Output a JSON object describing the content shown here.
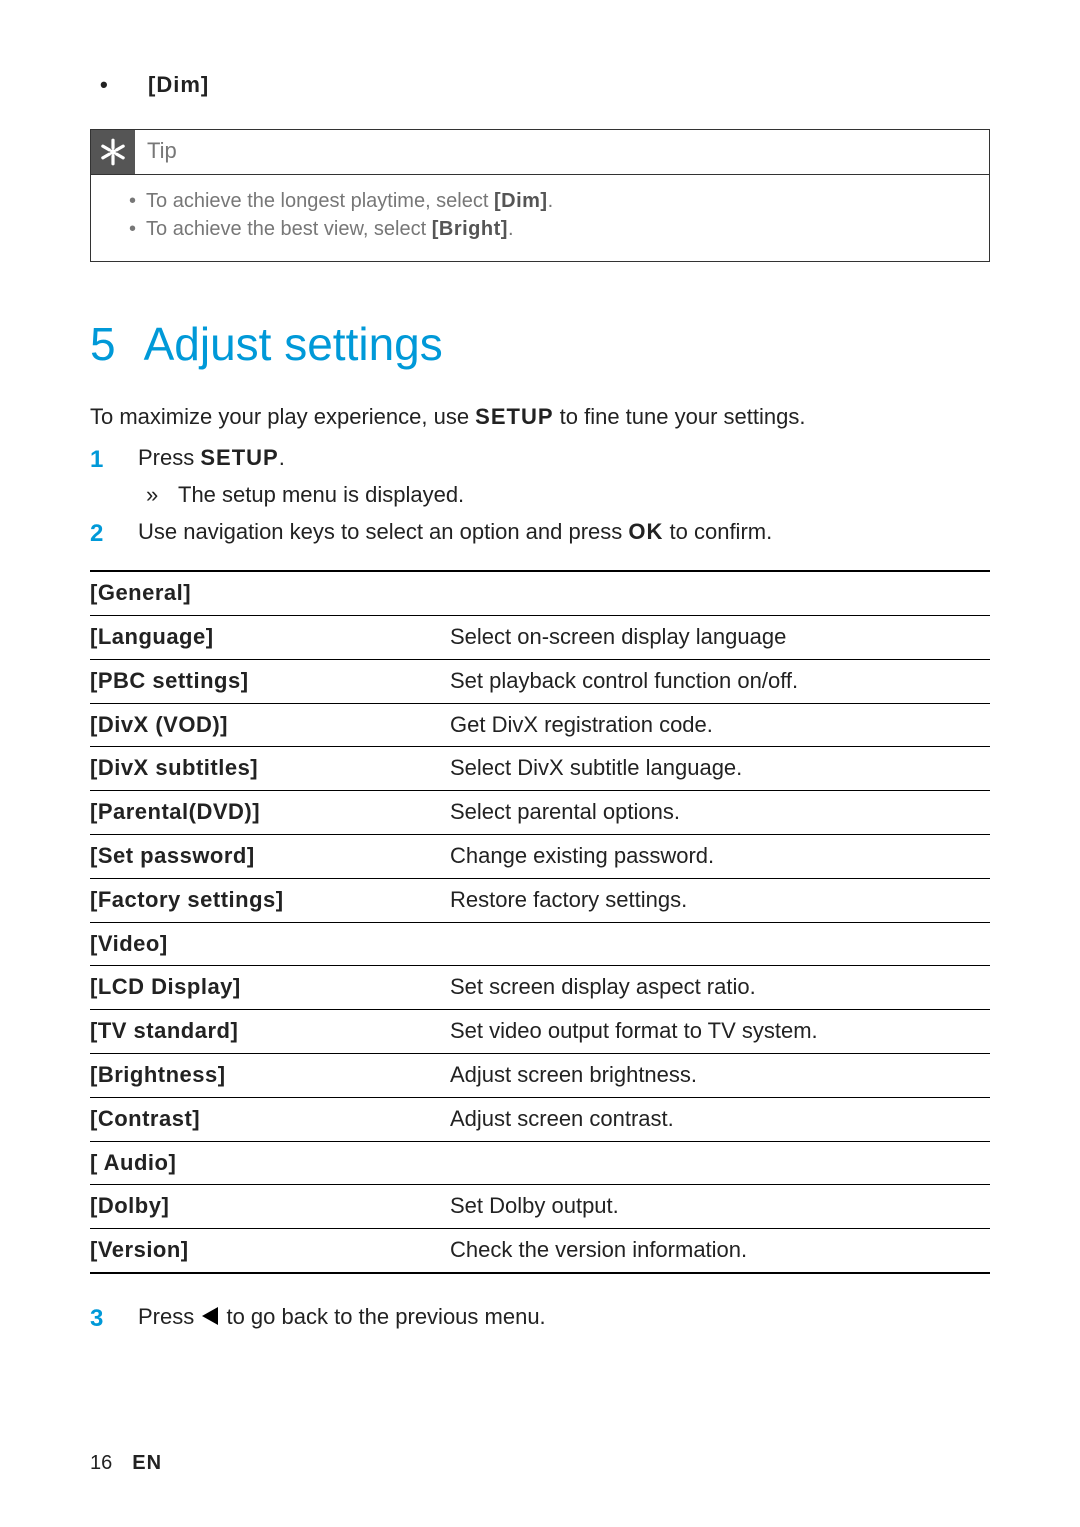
{
  "top_bullet": "[Dim]",
  "tip": {
    "title": "Tip",
    "items": [
      {
        "pre": "To achieve the longest playtime, select ",
        "bold": "[Dim]",
        "post": "."
      },
      {
        "pre": "To achieve the best view, select ",
        "bold": "[Bright]",
        "post": "."
      }
    ]
  },
  "section": {
    "num": "5",
    "title": "Adjust settings"
  },
  "intro": {
    "pre": "To maximize your play experience, use ",
    "bold": "SETUP",
    "post": " to fine tune your settings."
  },
  "steps": [
    {
      "num": "1",
      "parts": {
        "pre": "Press ",
        "bold": "SETUP",
        "post": "."
      },
      "sub": {
        "arrow": "»",
        "text": "The setup menu is displayed."
      }
    },
    {
      "num": "2",
      "parts": {
        "pre": "Use navigation keys to select an option and press ",
        "bold": "OK",
        "post": " to confirm."
      }
    }
  ],
  "table": [
    {
      "left": "[General]",
      "right": ""
    },
    {
      "left": "[Language]",
      "right": "Select on-screen display language"
    },
    {
      "left": "[PBC settings]",
      "right": "Set playback control function on/off."
    },
    {
      "left": "[DivX (VOD)]",
      "right": "Get DivX registration code."
    },
    {
      "left": "[DivX subtitles]",
      "right": "Select DivX subtitle language."
    },
    {
      "left": "[Parental(DVD)]",
      "right": "Select parental options."
    },
    {
      "left": "[Set password]",
      "right": "Change existing password."
    },
    {
      "left": "[Factory settings]",
      "right": "Restore factory settings."
    },
    {
      "left": "[Video]",
      "right": ""
    },
    {
      "left": "[LCD Display]",
      "right": "Set screen display aspect ratio."
    },
    {
      "left": "[TV standard]",
      "right": "Set video output format to TV system."
    },
    {
      "left": "[Brightness]",
      "right": "Adjust screen brightness."
    },
    {
      "left": "[Contrast]",
      "right": "Adjust screen contrast."
    },
    {
      "left": "[ Audio]",
      "right": ""
    },
    {
      "left": "[Dolby]",
      "right": "Set Dolby output."
    },
    {
      "left": "[Version]",
      "right": "Check the version information."
    }
  ],
  "step3": {
    "num": "3",
    "pre": "Press ",
    "post": " to go back to the previous menu."
  },
  "footer": {
    "page": "16",
    "lang": "EN"
  }
}
